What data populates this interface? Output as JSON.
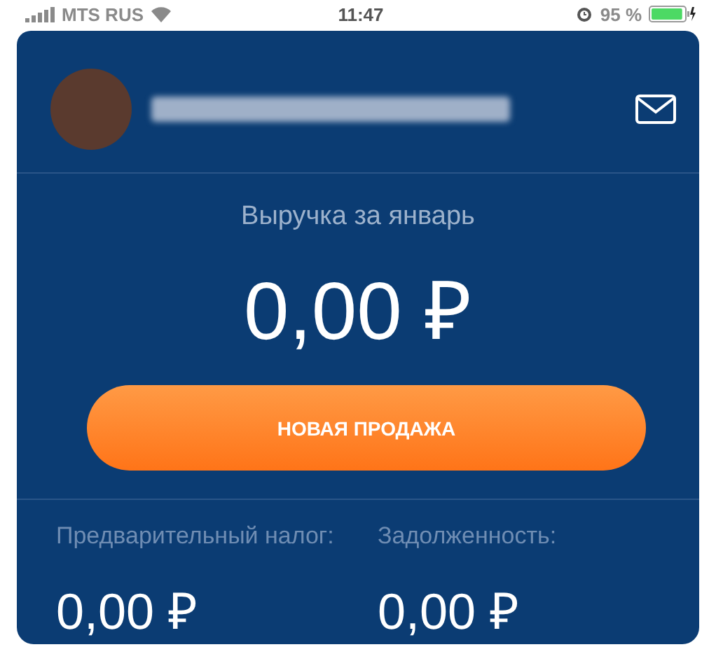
{
  "status_bar": {
    "carrier": "MTS RUS",
    "time": "11:47",
    "battery": "95 %",
    "level": 0.95
  },
  "revenue": {
    "label": "Выручка за январь",
    "value": "0,00 ₽"
  },
  "new_sale_button": {
    "label": "НОВАЯ ПРОДАЖА"
  },
  "stats": [
    {
      "label": "Предварительный налог:",
      "value": "0,00 ₽"
    },
    {
      "label": "Задолженность:",
      "value": "0,00 ₽"
    }
  ]
}
